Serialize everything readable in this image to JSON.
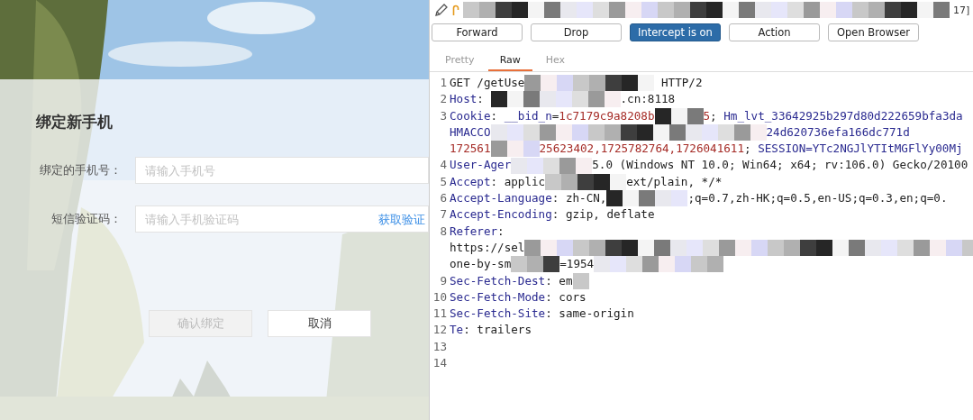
{
  "page": {
    "heading": "绑定新手机",
    "fields": [
      {
        "label": "绑定的手机号：",
        "placeholder": "请输入手机号"
      },
      {
        "label": "短信验证码：",
        "placeholder": "请输入手机验证码",
        "link": "获取验证"
      }
    ],
    "buttons": [
      {
        "label": "确认绑定",
        "disabled": true
      },
      {
        "label": "取消",
        "disabled": false
      }
    ]
  },
  "proxy": {
    "title": [
      {
        "kind": "titlemask"
      },
      {
        "kind": "text",
        "text": "17]"
      }
    ],
    "buttons": [
      {
        "label": "Forward",
        "selected": false
      },
      {
        "label": "Drop",
        "selected": false
      },
      {
        "label": "Intercept is on",
        "selected": true
      },
      {
        "label": "Action",
        "selected": false
      },
      {
        "label": "Open Browser",
        "selected": false
      }
    ],
    "tabs": [
      {
        "label": "Pretty",
        "selected": false
      },
      {
        "label": "Raw",
        "selected": true
      },
      {
        "label": "Hex",
        "selected": false
      }
    ],
    "lines": [
      {
        "number": "1",
        "wraps": [
          {
            "segments": [
              {
                "kind": "text",
                "text": "GET /getUse"
              },
              {
                "kind": "longmask"
              },
              {
                "kind": "text",
                "text": " HTTP/2"
              }
            ]
          }
        ]
      },
      {
        "number": "2",
        "wraps": [
          {
            "segments": [
              {
                "kind": "key",
                "text": "Host"
              },
              {
                "kind": "text",
                "text": ": "
              },
              {
                "kind": "longmask"
              },
              {
                "kind": "text",
                "text": ".cn:8118"
              }
            ]
          }
        ]
      },
      {
        "number": "3",
        "wraps": [
          {
            "segments": [
              {
                "kind": "key",
                "text": "Cookie"
              },
              {
                "kind": "text",
                "text": ": "
              },
              {
                "kind": "key",
                "text": "__bid_n"
              },
              {
                "kind": "text",
                "text": "="
              },
              {
                "kind": "value",
                "text": "1c7179c9a8208b"
              },
              {
                "kind": "shortmask"
              },
              {
                "kind": "value",
                "text": "5"
              },
              {
                "kind": "text",
                "text": "; "
              },
              {
                "kind": "key",
                "text": "Hm_lvt_33642925b297d80d222659bfa3da"
              }
            ]
          },
          {
            "segments": [
              {
                "kind": "key",
                "text": "HMACCO"
              },
              {
                "kind": "widemask"
              },
              {
                "kind": "key",
                "text": "24d620736efa166dc771d"
              }
            ]
          },
          {
            "segments": [
              {
                "kind": "value",
                "text": "172561"
              },
              {
                "kind": "shortmask"
              },
              {
                "kind": "value",
                "text": "25623402,1725782764,1726041611"
              },
              {
                "kind": "text",
                "text": "; "
              },
              {
                "kind": "key",
                "text": "SESSION=YTc2NGJlYTItMGFlYy00Mj"
              }
            ]
          }
        ]
      },
      {
        "number": "4",
        "wraps": [
          {
            "segments": [
              {
                "kind": "key",
                "text": "User-Ager"
              },
              {
                "kind": "mediummask"
              },
              {
                "kind": "text",
                "text": "5.0 (Windows NT 10.0; Win64; x64; rv:106.0) Gecko/20100"
              }
            ]
          }
        ]
      },
      {
        "number": "5",
        "wraps": [
          {
            "segments": [
              {
                "kind": "key",
                "text": "Accept"
              },
              {
                "kind": "text",
                "text": ": applic"
              },
              {
                "kind": "mediummask"
              },
              {
                "kind": "text",
                "text": "ext/plain, */*"
              }
            ]
          }
        ]
      },
      {
        "number": "6",
        "wraps": [
          {
            "segments": [
              {
                "kind": "key",
                "text": "Accept-Language"
              },
              {
                "kind": "text",
                "text": ": zh-CN,"
              },
              {
                "kind": "mediummask"
              },
              {
                "kind": "text",
                "text": ";q=0.7,zh-HK;q=0.5,en-US;q=0.3,en;q=0."
              }
            ]
          }
        ]
      },
      {
        "number": "7",
        "wraps": [
          {
            "segments": [
              {
                "kind": "key",
                "text": "Accept-Encoding"
              },
              {
                "kind": "text",
                "text": ": gzip, deflate"
              }
            ]
          }
        ]
      },
      {
        "number": "8",
        "wraps": [
          {
            "segments": [
              {
                "kind": "key",
                "text": "Referer"
              },
              {
                "kind": "text",
                "text": ":"
              }
            ]
          },
          {
            "segments": [
              {
                "kind": "text",
                "text": "https://sel"
              },
              {
                "kind": "fullmask"
              }
            ]
          },
          {
            "segments": [
              {
                "kind": "text",
                "text": "one-by-sm"
              },
              {
                "kind": "shortmask"
              },
              {
                "kind": "text",
                "text": "=1954"
              },
              {
                "kind": "longmask"
              }
            ]
          }
        ]
      },
      {
        "number": "9",
        "wraps": [
          {
            "segments": [
              {
                "kind": "key",
                "text": "Sec-Fetch-Dest"
              },
              {
                "kind": "text",
                "text": ": em"
              },
              {
                "kind": "tinymask"
              }
            ]
          }
        ]
      },
      {
        "number": "10",
        "wraps": [
          {
            "segments": [
              {
                "kind": "key",
                "text": "Sec-Fetch-Mode"
              },
              {
                "kind": "text",
                "text": ": cors"
              }
            ]
          }
        ]
      },
      {
        "number": "11",
        "wraps": [
          {
            "segments": [
              {
                "kind": "key",
                "text": "Sec-Fetch-Site"
              },
              {
                "kind": "text",
                "text": ": same-origin"
              }
            ]
          }
        ]
      },
      {
        "number": "12",
        "wraps": [
          {
            "segments": [
              {
                "kind": "key",
                "text": "Te"
              },
              {
                "kind": "text",
                "text": ": trailers"
              }
            ]
          }
        ]
      },
      {
        "number": "13"
      },
      {
        "number": "14"
      }
    ]
  }
}
